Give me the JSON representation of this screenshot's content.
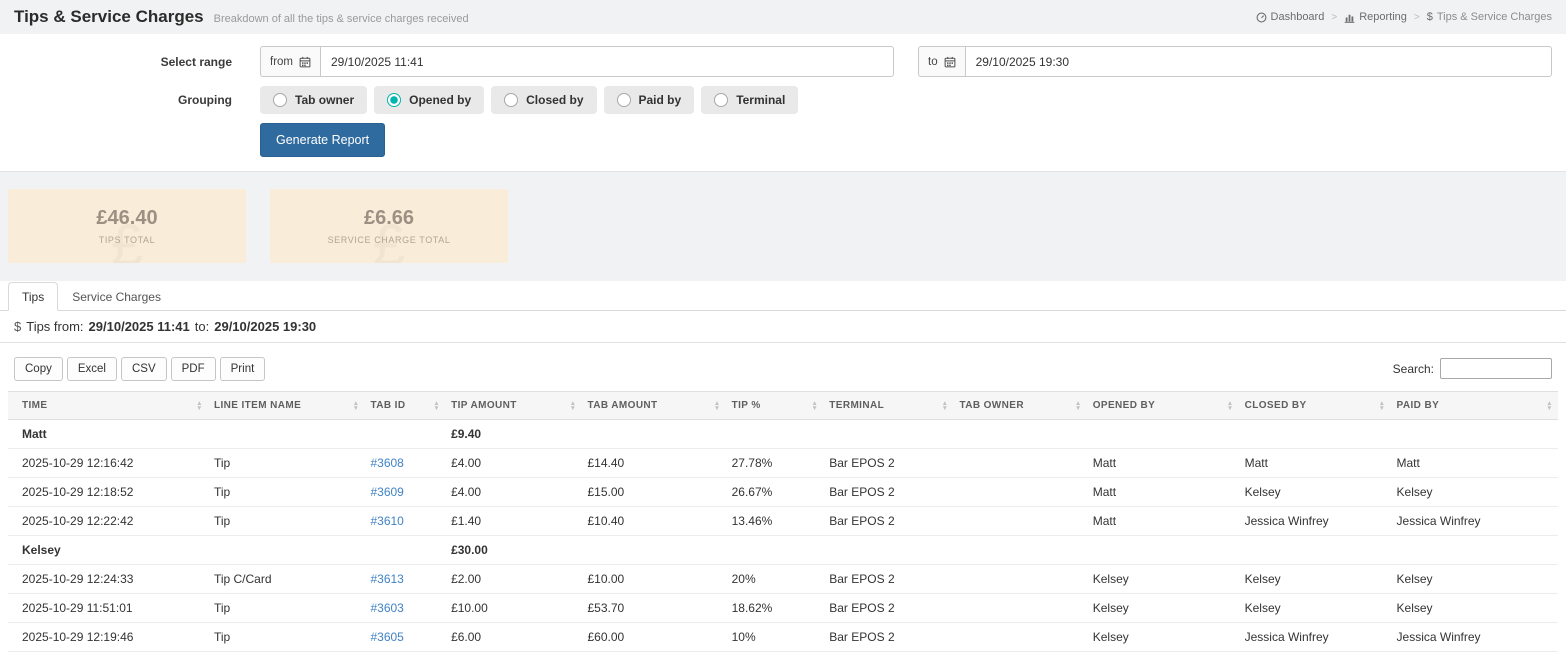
{
  "page": {
    "title": "Tips & Service Charges",
    "subtitle": "Breakdown of all the tips & service charges received"
  },
  "breadcrumb": {
    "items": [
      {
        "label": "Dashboard",
        "icon": "dashboard-icon"
      },
      {
        "label": "Reporting",
        "icon": "bar-chart-icon"
      },
      {
        "label": "Tips & Service Charges",
        "icon": "dollar-icon"
      }
    ],
    "separator": ">"
  },
  "form": {
    "select_range_label": "Select range",
    "from_label": "from",
    "from_value": "29/10/2025 11:41",
    "to_label": "to",
    "to_value": "29/10/2025 19:30",
    "grouping_label": "Grouping",
    "grouping_options": [
      {
        "label": "Tab owner",
        "selected": false
      },
      {
        "label": "Opened by",
        "selected": true
      },
      {
        "label": "Closed by",
        "selected": false
      },
      {
        "label": "Paid by",
        "selected": false
      },
      {
        "label": "Terminal",
        "selected": false
      }
    ],
    "generate_button": "Generate Report"
  },
  "summary_cards": [
    {
      "name": "tips-total-card",
      "value": "£46.40",
      "label": "TIPS TOTAL"
    },
    {
      "name": "service-charge-total-card",
      "value": "£6.66",
      "label": "SERVICE CHARGE TOTAL"
    }
  ],
  "tabs": [
    {
      "label": "Tips",
      "active": true
    },
    {
      "label": "Service Charges",
      "active": false
    }
  ],
  "report": {
    "prefix": "Tips from:",
    "from_date": "29/10/2025 11:41",
    "to_word": "to:",
    "to_date": "29/10/2025 19:30"
  },
  "toolbar": {
    "buttons": [
      "Copy",
      "Excel",
      "CSV",
      "PDF",
      "Print"
    ],
    "search_label": "Search:"
  },
  "table": {
    "columns": [
      "TIME",
      "LINE ITEM NAME",
      "TAB ID",
      "TIP AMOUNT",
      "TAB AMOUNT",
      "TIP %",
      "TERMINAL",
      "TAB OWNER",
      "OPENED BY",
      "CLOSED BY",
      "PAID BY"
    ],
    "groups": [
      {
        "name": "Matt",
        "total": "£9.40",
        "rows": [
          [
            "2025-10-29 12:16:42",
            "Tip",
            "#3608",
            "£4.00",
            "£14.40",
            "27.78%",
            "Bar EPOS 2",
            "",
            "Matt",
            "Matt",
            "Matt"
          ],
          [
            "2025-10-29 12:18:52",
            "Tip",
            "#3609",
            "£4.00",
            "£15.00",
            "26.67%",
            "Bar EPOS 2",
            "",
            "Matt",
            "Kelsey",
            "Kelsey"
          ],
          [
            "2025-10-29 12:22:42",
            "Tip",
            "#3610",
            "£1.40",
            "£10.40",
            "13.46%",
            "Bar EPOS 2",
            "",
            "Matt",
            "Jessica Winfrey",
            "Jessica Winfrey"
          ]
        ]
      },
      {
        "name": "Kelsey",
        "total": "£30.00",
        "rows": [
          [
            "2025-10-29 12:24:33",
            "Tip C/Card",
            "#3613",
            "£2.00",
            "£10.00",
            "20%",
            "Bar EPOS 2",
            "",
            "Kelsey",
            "Kelsey",
            "Kelsey"
          ],
          [
            "2025-10-29 11:51:01",
            "Tip",
            "#3603",
            "£10.00",
            "£53.70",
            "18.62%",
            "Bar EPOS 2",
            "",
            "Kelsey",
            "Kelsey",
            "Kelsey"
          ],
          [
            "2025-10-29 12:19:46",
            "Tip",
            "#3605",
            "£6.00",
            "£60.00",
            "10%",
            "Bar EPOS 2",
            "",
            "Kelsey",
            "Jessica Winfrey",
            "Jessica Winfrey"
          ]
        ]
      }
    ]
  }
}
